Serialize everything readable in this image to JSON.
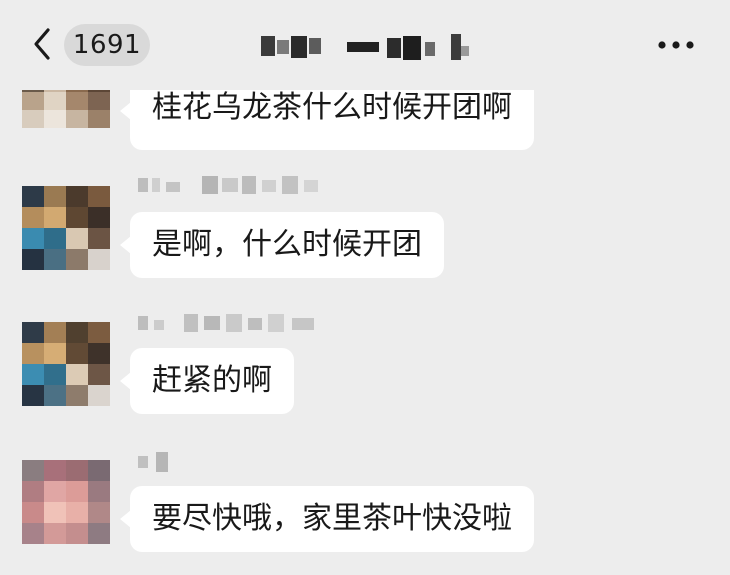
{
  "header": {
    "unread_count": "1691",
    "back_icon": "chevron-left-icon",
    "more_icon": "ellipsis-icon"
  },
  "messages": [
    {
      "text": "桂花乌龙茶什么时候开团啊"
    },
    {
      "text": "是啊，什么时候开团"
    },
    {
      "text": "赶紧的啊"
    },
    {
      "text": "要尽快哦，家里茶叶快没啦"
    }
  ],
  "colors": {
    "background": "#ededed",
    "bubble": "#ffffff",
    "badge": "#d9d9d9",
    "text": "#191919"
  }
}
